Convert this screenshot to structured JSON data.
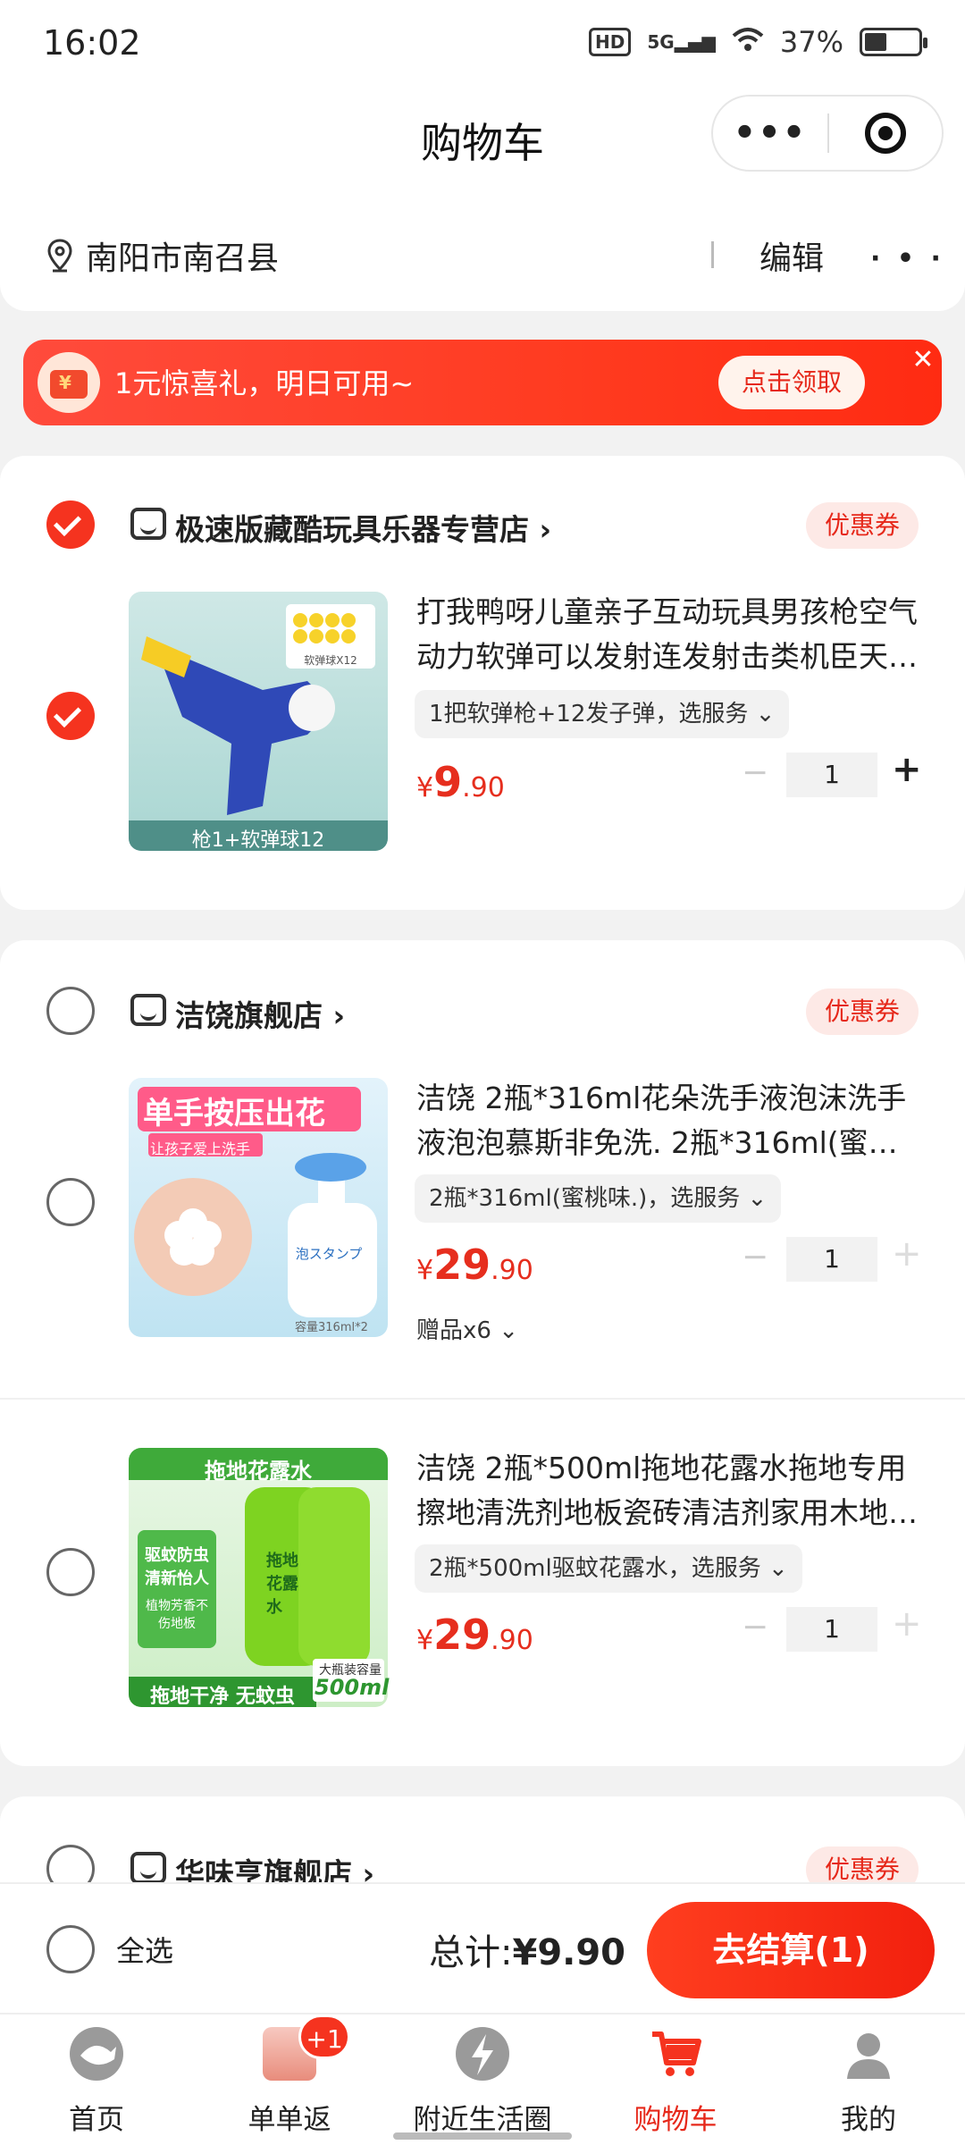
{
  "status_bar": {
    "time": "16:02",
    "hd": "HD",
    "network": "5G",
    "battery": "37%"
  },
  "header": {
    "title": "购物车"
  },
  "address": {
    "location": "南阳市南召县",
    "edit_label": "编辑"
  },
  "banner": {
    "text": "1元惊喜礼，明日可用~",
    "claim_label": "点击领取"
  },
  "stores": [
    {
      "name": "极速版藏酷玩具乐器专营店",
      "coupon": "优惠券",
      "selected": true,
      "products": [
        {
          "title": "打我鸭呀儿童亲子互动玩具男孩枪空气动力软弹可以发射连发射击类机臣天…",
          "spec": "1把软弹枪+12发子弹，选服务",
          "price_int": "9",
          "price_dec": ".90",
          "currency": "¥",
          "qty": "1",
          "selected": true,
          "image_caption": "枪1+软弹球12",
          "image_tag": "软弹球X12"
        }
      ]
    },
    {
      "name": "洁饶旗舰店",
      "coupon": "优惠券",
      "selected": false,
      "products": [
        {
          "title": "洁饶 2瓶*316ml花朵洗手液泡沫洗手液泡泡慕斯非免洗. 2瓶*316ml(蜜桃…",
          "spec": "2瓶*316ml(蜜桃味.)，选服务",
          "price_int": "29",
          "price_dec": ".90",
          "currency": "¥",
          "qty": "1",
          "gifts": "赠品x6",
          "selected": false,
          "image_headline": "单手按压出花",
          "image_sub": "让孩子爱上洗手",
          "image_label": "泡スタンプ",
          "image_volume": "容量316ml*2"
        },
        {
          "title": "洁饶 2瓶*500ml拖地花露水拖地专用擦地清洗剂地板瓷砖清洁剂家用木地…",
          "spec": "2瓶*500ml驱蚊花露水，选服务",
          "price_int": "29",
          "price_dec": ".90",
          "currency": "¥",
          "qty": "1",
          "selected": false,
          "image_headline": "拖地花露水",
          "image_side1": "驱蚊防虫清新怡人",
          "image_side2": "植物芳香不伤地板",
          "image_bottle": "拖地花露水",
          "image_footer": "拖地干净 无蚊虫",
          "image_volume_tag": "大瓶装容量",
          "image_volume": "500ml"
        }
      ]
    },
    {
      "name": "华味亨旗舰店",
      "coupon": "优惠券",
      "selected": false
    }
  ],
  "checkout": {
    "select_all_label": "全选",
    "total_label": "总计:",
    "total_value": "¥9.90",
    "pay_label": "去结算(1)"
  },
  "tabbar": {
    "items": [
      {
        "label": "首页",
        "icon": "home-fish-icon"
      },
      {
        "label": "单单返",
        "icon": "cashback-product-icon",
        "badge": "+1"
      },
      {
        "label": "附近生活圈",
        "icon": "lightning-icon"
      },
      {
        "label": "购物车",
        "icon": "cart-icon",
        "active": true
      },
      {
        "label": "我的",
        "icon": "profile-icon"
      }
    ]
  },
  "colors": {
    "accent": "#f5331f",
    "price": "#e62e1e",
    "coupon_bg": "#fde9e6"
  }
}
